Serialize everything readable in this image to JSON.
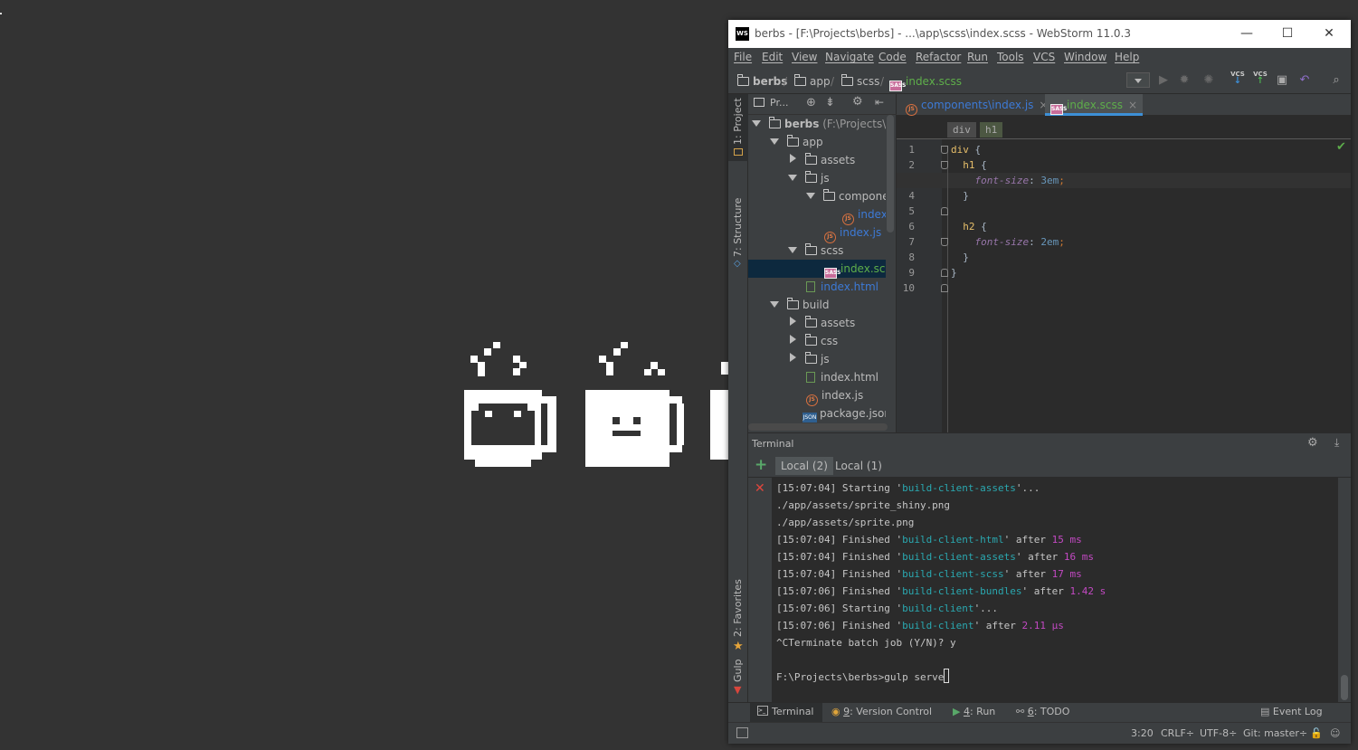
{
  "window": {
    "title": "berbs - [F:\\Projects\\berbs] - ...\\app\\scss\\index.scss - WebStorm 11.0.3",
    "logo": "WS",
    "minimize": "—",
    "maximize": "☐",
    "close": "✕"
  },
  "menu": [
    "File",
    "Edit",
    "View",
    "Navigate",
    "Code",
    "Refactor",
    "Run",
    "Tools",
    "VCS",
    "Window",
    "Help"
  ],
  "navbar": {
    "crumbs": [
      "berbs",
      "app",
      "scss",
      "index.scss"
    ],
    "vcs_label": "VCS"
  },
  "left_strip": {
    "project_tab": "1: Project",
    "structure_tab": "7: Structure",
    "favorites_tab": "2: Favorites",
    "gulp_tab": "Gulp"
  },
  "project_panel": {
    "view_label": "Pr...",
    "tree": {
      "root": "berbs",
      "root_path": " (F:\\Projects\\be",
      "app": "app",
      "assets": "assets",
      "js": "js",
      "components": "compone",
      "components_index": "index",
      "js_index": "index.js",
      "scss": "scss",
      "scss_index": "index.scss",
      "index_html": "index.html",
      "build": "build",
      "build_assets": "assets",
      "build_css": "css",
      "build_js": "js",
      "build_index_html": "index.html",
      "build_index_js": "index.js",
      "package_json": "package.json"
    }
  },
  "editor": {
    "tabs": [
      {
        "label": "components\\index.js"
      },
      {
        "label": "index.scss"
      }
    ],
    "breadcrumb": [
      "div",
      "h1"
    ],
    "line_numbers": [
      "1",
      "2",
      "3",
      "4",
      "5",
      "6",
      "7",
      "8",
      "9",
      "10"
    ],
    "code": {
      "l1_sel": "div",
      "l1_rest": " {",
      "l2_sel": "  h1",
      "l2_rest": " {",
      "l3_prop": "    font-size",
      "l3_colon": ": ",
      "l3_num": "3",
      "l3_unit": "em",
      "l3_semi": ";",
      "l4": "  }",
      "l6_sel": "  h2",
      "l6_rest": " {",
      "l7_prop": "    font-size",
      "l7_colon": ": ",
      "l7_num": "2",
      "l7_unit": "em",
      "l7_semi": ";",
      "l8": "  }",
      "l9": "}"
    }
  },
  "terminal": {
    "title": "Terminal",
    "tabs": [
      "Local (2)",
      "Local (1)"
    ],
    "lines": {
      "l1a": "[15:07:04] Starting '",
      "l1b": "build-client-assets",
      "l1c": "'...",
      "l2": "./app/assets/sprite_shiny.png",
      "l3": "./app/assets/sprite.png",
      "l4a": "[15:07:04] Finished '",
      "l4b": "build-client-html",
      "l4c": "' after ",
      "l4d": "15 ms",
      "l5a": "[15:07:04] Finished '",
      "l5b": "build-client-assets",
      "l5c": "' after ",
      "l5d": "16 ms",
      "l6a": "[15:07:04] Finished '",
      "l6b": "build-client-scss",
      "l6c": "' after ",
      "l6d": "17 ms",
      "l7a": "[15:07:06] Finished '",
      "l7b": "build-client-bundles",
      "l7c": "' after ",
      "l7d": "1.42 s",
      "l8a": "[15:07:06] Starting '",
      "l8b": "build-client",
      "l8c": "'...",
      "l9a": "[15:07:06] Finished '",
      "l9b": "build-client",
      "l9c": "' after ",
      "l9d": "2.11 μs",
      "l10": "^CTerminate batch job (Y/N)? y",
      "prompt": "F:\\Projects\\berbs>gulp serve"
    }
  },
  "tool_tabs": {
    "terminal": "Terminal",
    "vcs_num": "9",
    "vcs": ": Version Control",
    "run_num": "4",
    "run": ": Run",
    "todo_num": "6",
    "todo": ": TODO",
    "event_log": "Event Log"
  },
  "status": {
    "position": "3:20",
    "line_sep": "CRLF÷",
    "encoding": "UTF-8÷",
    "git": "Git: master÷"
  },
  "colors": {
    "desktop": "#333333",
    "ide_bg": "#3c3f41",
    "editor_bg": "#2b2b2b",
    "selector": "#e8bf6a",
    "property": "#9876aa",
    "number": "#6897bb",
    "task_name": "#2aa8b0",
    "duration": "#c349c3",
    "scss_file": "#5eae4a",
    "js_file": "#3d7ad6"
  }
}
